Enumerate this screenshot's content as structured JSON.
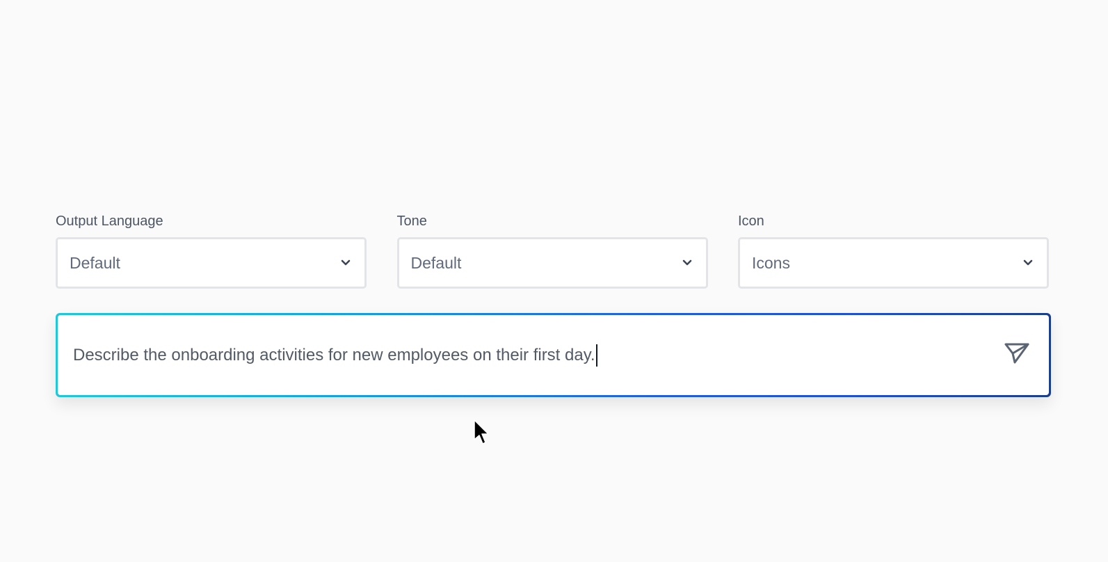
{
  "settings": {
    "output_language": {
      "label": "Output Language",
      "value": "Default",
      "icon": "chevron-down-icon"
    },
    "tone": {
      "label": "Tone",
      "value": "Default",
      "icon": "chevron-down-icon"
    },
    "icon": {
      "label": "Icon",
      "value": "Icons",
      "icon": "chevron-down-icon"
    }
  },
  "prompt": {
    "value": "Describe the onboarding activities for new employees on their first day.",
    "send_icon": "send-icon"
  },
  "colors": {
    "background": "#fafafa",
    "gradient_start": "#1fc8d8",
    "gradient_mid": "#1e5ee0",
    "gradient_end": "#1b3f8e",
    "label_text": "#4b5563",
    "value_text": "#606a7b"
  }
}
